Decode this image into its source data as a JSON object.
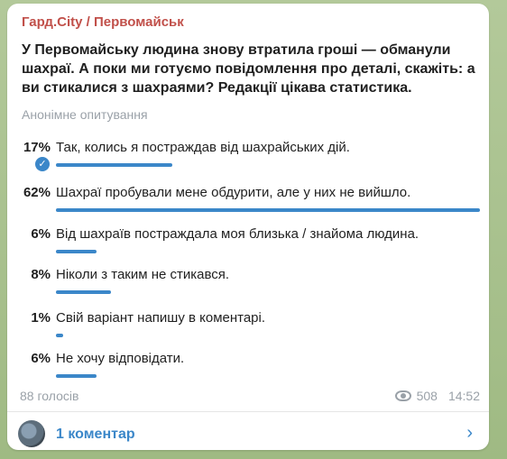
{
  "channel_name": "Гард.City / Первомайськ",
  "question": "У Первомайську людина знову втратила гроші — обманули шахраї. А поки ми готуємо повідомлення про деталі, скажіть: а ви стикалися з шахраями? Редакції цікава статистика.",
  "poll_type": "Анонімне опитування",
  "options": [
    {
      "percent": "17%",
      "label": "Так, колись я постраждав від шахрайських дій.",
      "fraction": 0.17,
      "selected": true
    },
    {
      "percent": "62%",
      "label": "Шахраї пробували мене обдурити, але у них не вийшло.",
      "fraction": 0.62,
      "selected": false
    },
    {
      "percent": "6%",
      "label": "Від шахраїв постраждала моя близька / знайома людина.",
      "fraction": 0.06,
      "selected": false
    },
    {
      "percent": "8%",
      "label": "Ніколи з таким не стикався.",
      "fraction": 0.08,
      "selected": false
    },
    {
      "percent": "1%",
      "label": "Свій варіант напишу в коментарі.",
      "fraction": 0.01,
      "selected": false
    },
    {
      "percent": "6%",
      "label": "Не хочу відповідати.",
      "fraction": 0.06,
      "selected": false
    }
  ],
  "votes": "88 голосів",
  "views": "508",
  "time": "14:52",
  "comments_label": "1 коментар",
  "colors": {
    "accent": "#3b87c9",
    "channel": "#c1504a"
  }
}
